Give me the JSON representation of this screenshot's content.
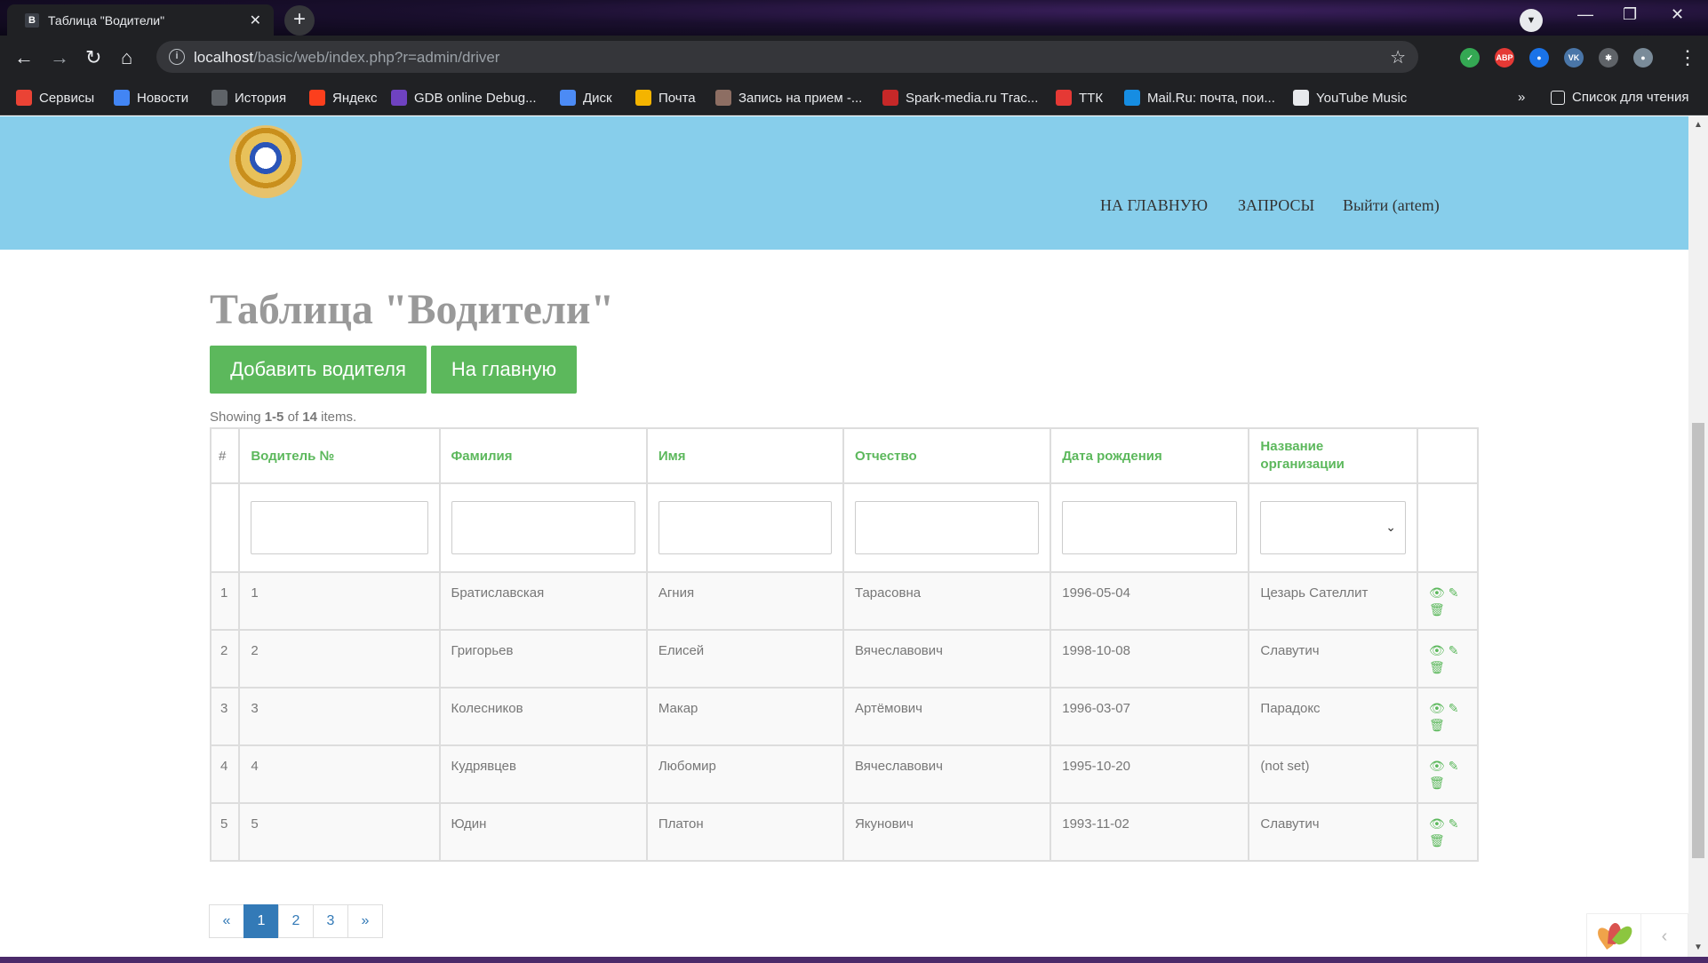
{
  "browser": {
    "tab_favicon": "B",
    "tab_title": "Таблица \"Водители\"",
    "tab_close": "✕",
    "new_tab": "+",
    "url_host": "localhost",
    "url_path": "/basic/web/index.php?r=admin/driver",
    "info_glyph": "i",
    "extensions": [
      {
        "name": "shield-extension",
        "label": "✓",
        "color": "#34a853"
      },
      {
        "name": "adblock-extension",
        "label": "ABP",
        "color": "#e53935"
      },
      {
        "name": "blue-extension",
        "label": "●",
        "color": "#1a73e8"
      },
      {
        "name": "vk-extension",
        "label": "VK",
        "color": "#4a76a8"
      },
      {
        "name": "puzzle-extension",
        "label": "✱",
        "color": "#5f6368"
      },
      {
        "name": "profile-avatar",
        "label": "●",
        "color": "#7a8b99"
      }
    ],
    "menu_glyph": "⋮"
  },
  "bookmarks": [
    {
      "label": "Сервисы",
      "icon": "apps-grid-icon",
      "color": "#ea4335"
    },
    {
      "label": "Новости",
      "icon": "news-icon",
      "color": "#4285f4"
    },
    {
      "label": "История",
      "icon": "history-icon",
      "color": "#5f6368"
    },
    {
      "label": "Яндекс",
      "icon": "yandex-icon",
      "color": "#fc3f1d"
    },
    {
      "label": "GDB online Debug...",
      "icon": "gdb-icon",
      "color": "#6f42c1"
    },
    {
      "label": "Диск",
      "icon": "disk-icon",
      "color": "#4c8bf5"
    },
    {
      "label": "Почта",
      "icon": "mail-icon",
      "color": "#f4b400"
    },
    {
      "label": "Запись на прием -...",
      "icon": "coat-of-arms-icon",
      "color": "#8d6e63"
    },
    {
      "label": "Spark-media.ru Тгас...",
      "icon": "spark-icon",
      "color": "#c62828"
    },
    {
      "label": "ТТК",
      "icon": "ttk-icon",
      "color": "#e53935"
    },
    {
      "label": "Mail.Ru: почта, пои...",
      "icon": "mailru-icon",
      "color": "#168de2"
    },
    {
      "label": "YouTube Music",
      "icon": "youtube-music-icon",
      "color": "#e8eaed"
    }
  ],
  "bookmarks_overflow": "»",
  "reading_list": "Список для чтения",
  "nav": {
    "home": "НА ГЛАВНУЮ",
    "requests": "ЗАПРОСЫ",
    "logout": "Выйти (artem)"
  },
  "page": {
    "title": "Таблица \"Водители\"",
    "add_button": "Добавить водителя",
    "home_button": "На главную",
    "summary_prefix": "Showing ",
    "summary_range": "1-5",
    "summary_of": " of ",
    "summary_total": "14",
    "summary_suffix": " items."
  },
  "table": {
    "columns": [
      "#",
      "Водитель №",
      "Фамилия",
      "Имя",
      "Отчество",
      "Дата рождения",
      "Название организации"
    ],
    "rows": [
      [
        "1",
        "1",
        "Братиславская",
        "Агния",
        "Тарасовна",
        "1996-05-04",
        "Цезарь Сателлит"
      ],
      [
        "2",
        "2",
        "Григорьев",
        "Елисей",
        "Вячеславович",
        "1998-10-08",
        "Славутич"
      ],
      [
        "3",
        "3",
        "Колесников",
        "Макар",
        "Артёмович",
        "1996-03-07",
        "Парадокс"
      ],
      [
        "4",
        "4",
        "Кудрявцев",
        "Любомир",
        "Вячеславович",
        "1995-10-20",
        "(not set)"
      ],
      [
        "5",
        "5",
        "Юдин",
        "Платон",
        "Якунович",
        "1993-11-02",
        "Славутич"
      ]
    ]
  },
  "pagination": {
    "prev": "«",
    "pages": [
      "1",
      "2",
      "3"
    ],
    "active": "1",
    "next": "»"
  },
  "colors": {
    "header_bg": "#87ceeb",
    "accent_green": "#5cb85c",
    "link_blue": "#337ab7"
  }
}
